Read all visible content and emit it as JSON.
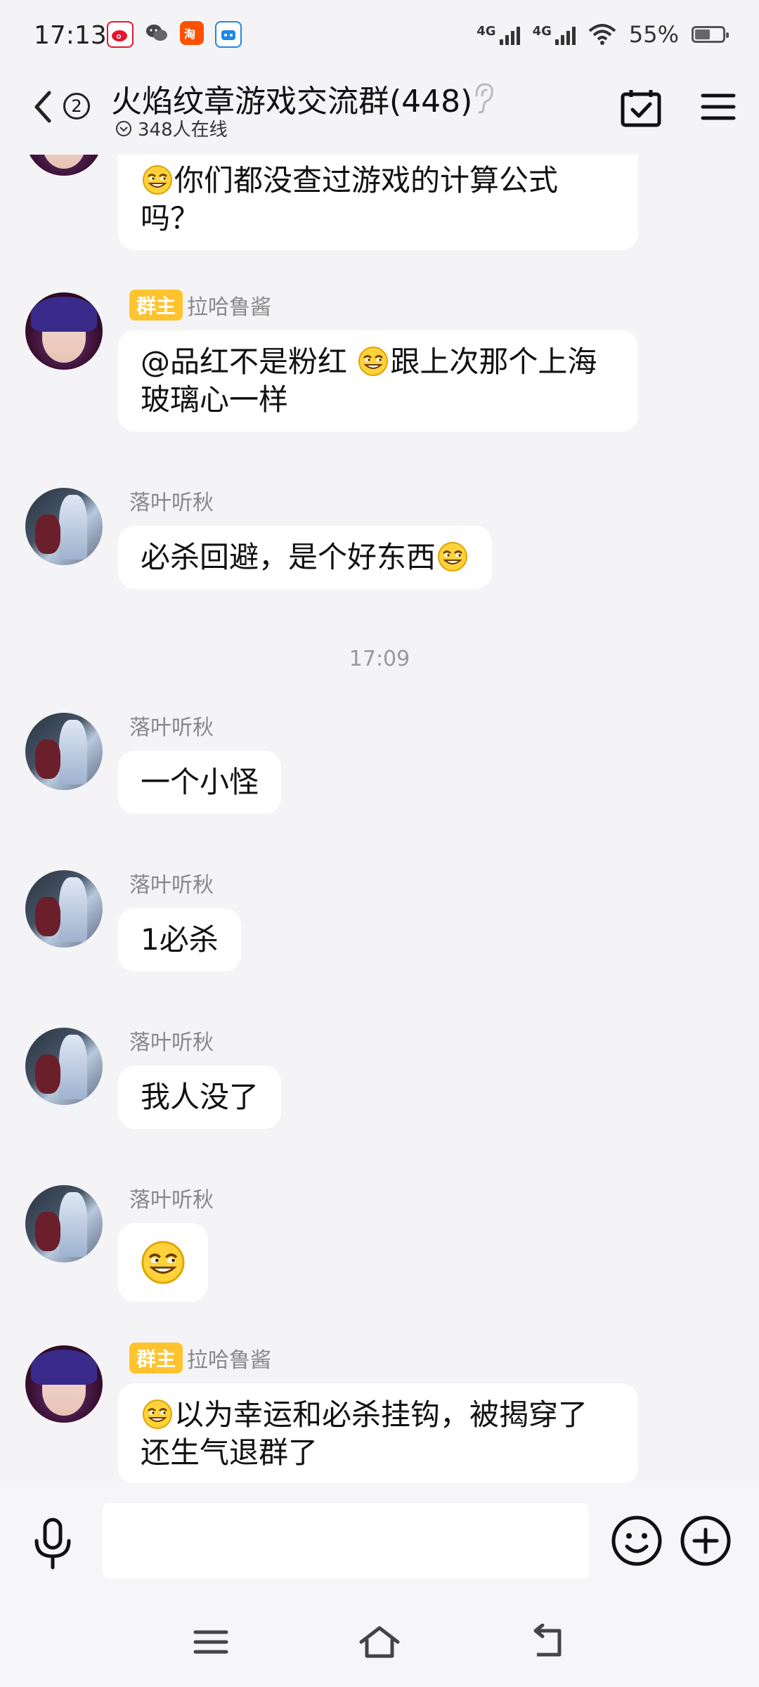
{
  "status_bar": {
    "time": "17:13",
    "network_1": "4G",
    "network_2": "4G",
    "battery_text": "55%",
    "battery_level": 0.55,
    "apps": [
      "weibo-icon",
      "wechat-icon",
      "taobao-icon",
      "bilibili-icon"
    ]
  },
  "header": {
    "unread_count": "2",
    "title": "火焰纹章游戏交流群(448)",
    "online_text": "348人在线"
  },
  "messages": [
    {
      "id": "m0",
      "sender": "",
      "role": "",
      "avatar": "boss",
      "parts": [
        {
          "emoji": true
        },
        {
          "text": "你们都没查过游戏的计算公式吗？"
        }
      ]
    },
    {
      "id": "m1",
      "sender": "拉哈鲁酱",
      "role": "群主",
      "avatar": "boss",
      "parts": [
        {
          "text": "@品红不是粉红 "
        },
        {
          "emoji": true
        },
        {
          "text": "跟上次那个上海玻璃心一样"
        }
      ]
    },
    {
      "id": "m2",
      "sender": "落叶听秋",
      "role": "",
      "avatar": "fall",
      "parts": [
        {
          "text": "必杀回避，是个好东西"
        },
        {
          "emoji": true
        }
      ]
    },
    {
      "id": "m3",
      "sender": "落叶听秋",
      "role": "",
      "avatar": "fall",
      "parts": [
        {
          "text": "一个小怪"
        }
      ]
    },
    {
      "id": "m4",
      "sender": "落叶听秋",
      "role": "",
      "avatar": "fall",
      "parts": [
        {
          "text": "1必杀"
        }
      ]
    },
    {
      "id": "m5",
      "sender": "落叶听秋",
      "role": "",
      "avatar": "fall",
      "parts": [
        {
          "text": "我人没了"
        }
      ]
    },
    {
      "id": "m6",
      "sender": "落叶听秋",
      "role": "",
      "avatar": "fall",
      "parts": [
        {
          "emoji": true
        }
      ]
    },
    {
      "id": "m7",
      "sender": "拉哈鲁酱",
      "role": "群主",
      "avatar": "boss",
      "parts": [
        {
          "emoji": true
        },
        {
          "text": "以为幸运和必杀挂钩，被揭穿了还生气退群了"
        }
      ]
    }
  ],
  "time_divider": "17:09",
  "input": {
    "placeholder": "",
    "value": ""
  },
  "colors": {
    "background": "#f4f4f6",
    "bubble": "#ffffff",
    "owner_badge": "#ffc32e",
    "name_gray": "#888888"
  }
}
